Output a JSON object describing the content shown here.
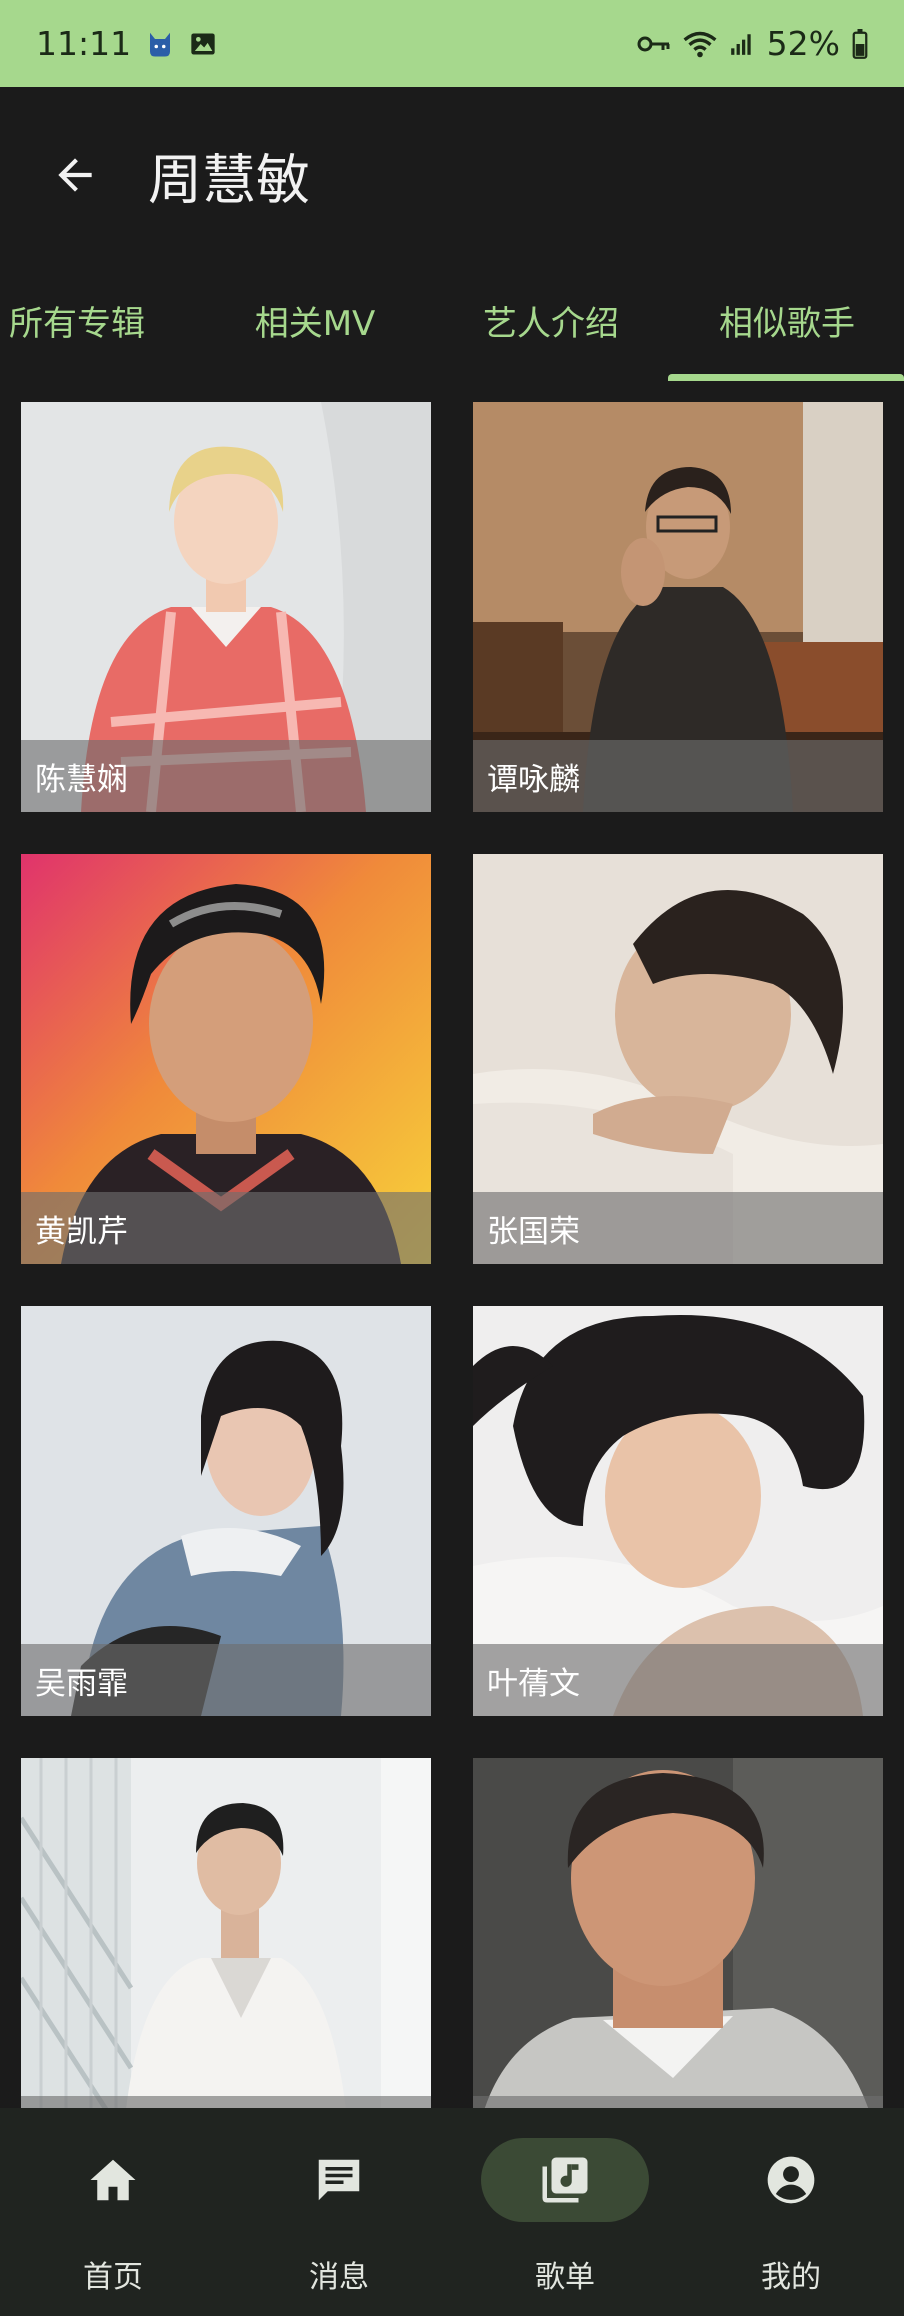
{
  "status_bar": {
    "time": "11:11",
    "battery": "52%",
    "icons": [
      "cat-icon",
      "image-icon",
      "key-icon",
      "wifi-icon",
      "signal-icon",
      "battery-icon"
    ]
  },
  "header": {
    "back_icon": "arrow-left-icon",
    "title": "周慧敏"
  },
  "tabs": [
    {
      "label": "所有专辑",
      "selected": false
    },
    {
      "label": "相关MV",
      "selected": false
    },
    {
      "label": "艺人介绍",
      "selected": false
    },
    {
      "label": "相似歌手",
      "selected": true
    }
  ],
  "artists": [
    {
      "name": "陈慧娴"
    },
    {
      "name": "谭咏麟"
    },
    {
      "name": "黄凯芹"
    },
    {
      "name": "张国荣"
    },
    {
      "name": "吴雨霏"
    },
    {
      "name": "叶蒨文"
    },
    {
      "name": ""
    },
    {
      "name": ""
    }
  ],
  "bottom_nav": [
    {
      "label": "首页",
      "icon": "home-icon",
      "active": false
    },
    {
      "label": "消息",
      "icon": "message-icon",
      "active": false
    },
    {
      "label": "歌单",
      "icon": "music-library-icon",
      "active": true
    },
    {
      "label": "我的",
      "icon": "account-icon",
      "active": false
    }
  ],
  "colors": {
    "accent": "#a6d88d",
    "background": "#1b1b1b",
    "nav_background": "#202420",
    "nav_active_pill": "#3b4a35"
  }
}
